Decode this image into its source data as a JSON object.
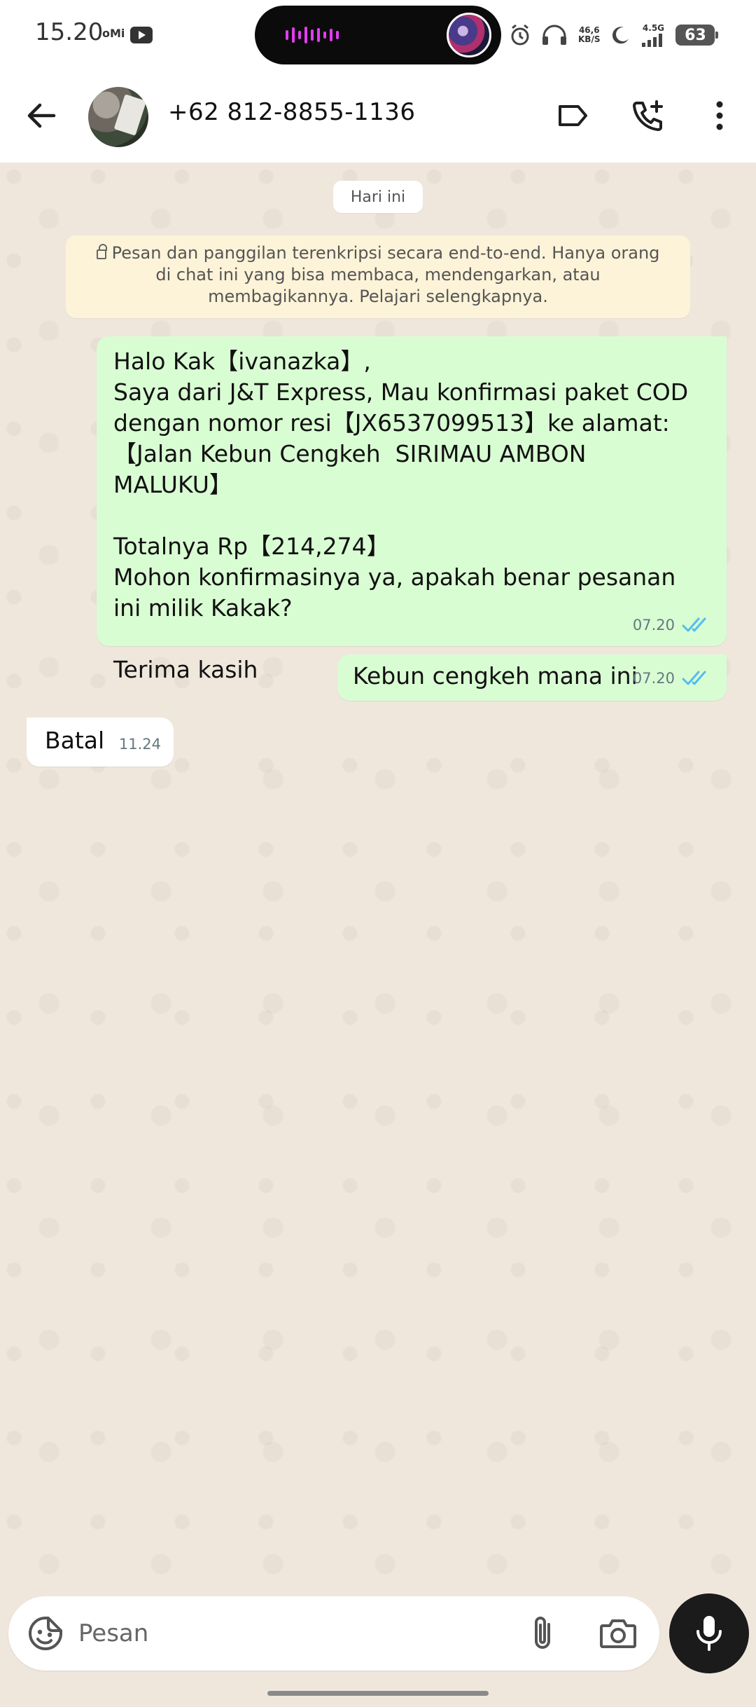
{
  "status_bar": {
    "time": "15.20",
    "carrier_badge": "oMi",
    "net_speed_value": "46,6",
    "net_speed_unit": "KB/S",
    "network_type": "4.5G",
    "battery": "63"
  },
  "header": {
    "contact_name": "+62 812-8855-1136",
    "icons": [
      "back-arrow-icon",
      "label-icon",
      "add-call-icon",
      "more-vert-icon"
    ]
  },
  "chat": {
    "date_label": "Hari ini",
    "encryption_notice": "Pesan dan panggilan terenkripsi secara end-to-end. Hanya orang di chat ini yang bisa membaca, mendengarkan, atau membagikannya. Pelajari selengkapnya.",
    "messages": [
      {
        "direction": "outgoing",
        "text": "Halo Kak【ivanazka】,\nSaya dari J&T Express, Mau konfirmasi paket COD dengan nomor resi【JX6537099513】ke alamat:\n【Jalan Kebun Cengkeh  SIRIMAU AMBON MALUKU】\n\nTotalnya Rp【214,274】\nMohon konfirmasinya ya, apakah benar pesanan ini milik Kakak?\n\nTerima kasih",
        "time": "07.20",
        "status": "read"
      },
      {
        "direction": "outgoing",
        "text": "Kebun cengkeh mana ini",
        "time": "07.20",
        "status": "read"
      },
      {
        "direction": "incoming",
        "text": "Batal",
        "time": "11.24"
      }
    ]
  },
  "composer": {
    "placeholder": "Pesan",
    "icons": [
      "sticker-icon",
      "attach-icon",
      "camera-icon",
      "mic-icon"
    ]
  },
  "colors": {
    "outgoing_bubble": "#d9fdd3",
    "incoming_bubble": "#ffffff",
    "chat_background": "#efe7dc",
    "read_ticks": "#53bdeb",
    "notice_background": "#fdf3d8"
  }
}
